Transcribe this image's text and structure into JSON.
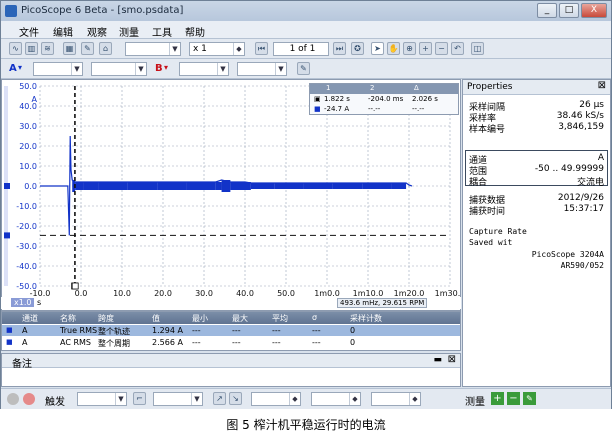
{
  "window": {
    "title": "PicoScope 6 Beta - [smo.psdata]",
    "buttons": [
      "_",
      "□",
      "X"
    ]
  },
  "menu": [
    "文件",
    "编辑",
    "观察",
    "测量",
    "工具",
    "帮助"
  ],
  "toolbar": {
    "multiplier": "x 1",
    "page": "1 of 1"
  },
  "channel_bar": {
    "a_label": "A",
    "b_label": "B"
  },
  "plot": {
    "y_unit": "A",
    "x_unit": "s",
    "x_zoom_label": "x1.0",
    "status": "493.6 mHz, 29.615 RPM",
    "trace_color": "#1233c8"
  },
  "chart_data": {
    "type": "line",
    "title": "",
    "xlabel": "s",
    "ylabel": "A",
    "xlim": [
      -10.0,
      130.0
    ],
    "ylim": [
      -50.0,
      50.0
    ],
    "x_ticks": [
      "-10.0",
      "0.0",
      "10.0",
      "20.0",
      "30.0",
      "40.0",
      "50.0",
      "1m0.0",
      "1m10.0",
      "1m20.0",
      "1m30.0"
    ],
    "y_ticks": [
      "50.0",
      "40.0",
      "30.0",
      "20.0",
      "10.0",
      "0.0",
      "-10.0",
      "-20.0",
      "-30.0",
      "-40.0",
      "-50.0"
    ],
    "series": [
      {
        "x": [
          -10,
          -0.5,
          0.0,
          0.3,
          0.6,
          1.0,
          2,
          5,
          10,
          20,
          30,
          40,
          50,
          52,
          55,
          60,
          62,
          70,
          80,
          90,
          100,
          110,
          115,
          116,
          117
        ],
        "y": [
          0,
          0,
          -24.7,
          25,
          8,
          3,
          2,
          2,
          2,
          2,
          2,
          2,
          2,
          3,
          2,
          2,
          1.5,
          1.5,
          1.5,
          1.5,
          1.5,
          1.5,
          1.5,
          0.5,
          0
        ]
      }
    ],
    "cursors_x": [
      1.822,
      2.026
    ],
    "cursor_y": -24.7
  },
  "cursor_table": {
    "headers": [
      "1",
      "2",
      "Δ"
    ],
    "row1": [
      "1.822 s",
      "-204.0 ms",
      "2.026 s"
    ],
    "row2": [
      "-24.7 A",
      "--.--",
      "--.--"
    ]
  },
  "measurements": {
    "columns": [
      "通道",
      "名称",
      "跨度",
      "值",
      "最小",
      "最大",
      "平均",
      "σ",
      "采样计数"
    ],
    "rows": [
      [
        "A",
        "True RMS",
        "整个轨迹",
        "1.294 A",
        "---",
        "---",
        "---",
        "---",
        "0"
      ],
      [
        "A",
        "AC RMS",
        "整个周期",
        "2.566 A",
        "---",
        "---",
        "---",
        "---",
        "0"
      ]
    ]
  },
  "notes": {
    "title": "备注"
  },
  "properties": {
    "title": "Properties",
    "group1": [
      {
        "label": "采样间隔",
        "value": "26 μs"
      },
      {
        "label": "采样率",
        "value": "38.46 kS/s"
      },
      {
        "label": "样本编号",
        "value": "3,846,159"
      }
    ],
    "group2": [
      {
        "label": "通道",
        "value": "A"
      },
      {
        "label": "范围",
        "value": "-50 .. 49.99999"
      },
      {
        "label": "耦合",
        "value": "交流电"
      }
    ],
    "group3": [
      {
        "label": "捕获数据",
        "value": "2012/9/26"
      },
      {
        "label": "捕获时间",
        "value": "15:37:17"
      }
    ],
    "capture_rate": "Capture Rate",
    "saved_with": "Saved wit",
    "device": "PicoScope 3204A",
    "device_id": "AR590/052"
  },
  "bottom": {
    "trigger_label": "触发",
    "measure_label": "测量"
  },
  "caption": "图 5  榨汁机平稳运行时的电流"
}
